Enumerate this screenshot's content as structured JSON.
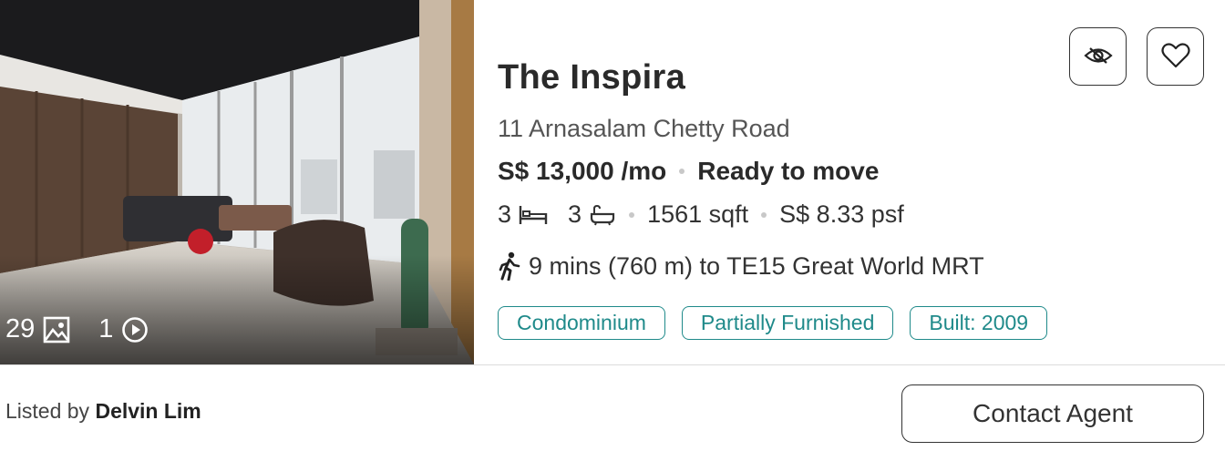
{
  "listing": {
    "title": "The Inspira",
    "address": "11 Arnasalam Chetty Road",
    "price": "S$ 13,000 /mo",
    "availability": "Ready to move",
    "bedrooms": "3",
    "bathrooms": "3",
    "area": "1561 sqft",
    "psf": "S$ 8.33 psf",
    "mrt": "9 mins (760 m) to TE15 Great World MRT",
    "tags": [
      "Condominium",
      "Partially Furnished",
      "Built: 2009"
    ]
  },
  "media": {
    "photo_count": "29",
    "video_count": "1"
  },
  "agent": {
    "listed_by_label": "Listed by",
    "name": "Delvin Lim"
  },
  "actions": {
    "contact_label": "Contact Agent"
  },
  "icons": {
    "photo": "image-icon",
    "video": "play-icon",
    "bed": "bed-icon",
    "bath": "bathtub-icon",
    "walk": "walking-person-icon",
    "hide": "eye-slash-icon",
    "favorite": "heart-icon"
  },
  "colors": {
    "tag_accent": "#1f8a8a",
    "text_primary": "#2a2a2a"
  }
}
